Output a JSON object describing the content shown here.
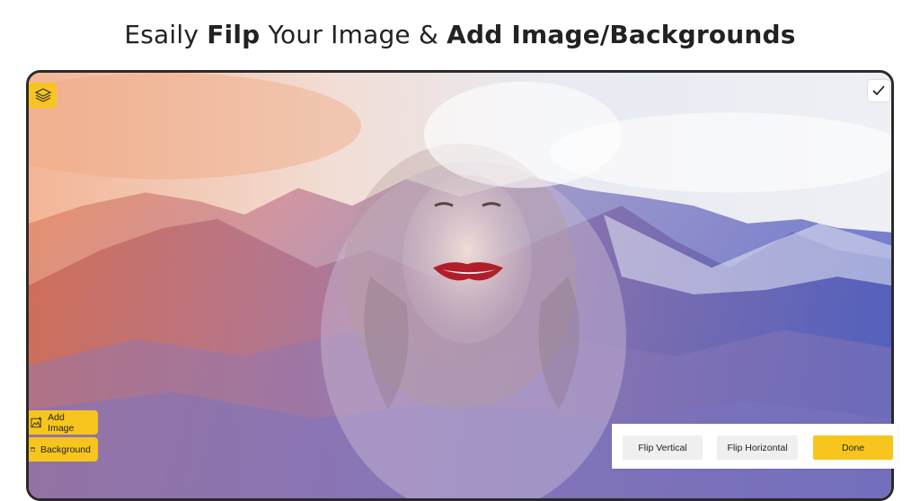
{
  "headline": {
    "part1": "Esaily ",
    "part2": "Filp",
    "part3": " Your Image & ",
    "part4": "Add Image/Backgrounds"
  },
  "editor": {
    "layers_icon": "layers-icon",
    "check_icon": "checkmark-icon",
    "add_image_label": "Add Image",
    "add_image_icon": "image-add-icon",
    "background_label": "Background",
    "background_icon": "background-icon"
  },
  "actions": {
    "flip_vertical": "Flip Vertical",
    "flip_horizontal": "Flip Horizontal",
    "done": "Done"
  },
  "colors": {
    "accent": "#f7c51e",
    "button_gray": "#efefef",
    "frame": "#2a2a2a"
  }
}
